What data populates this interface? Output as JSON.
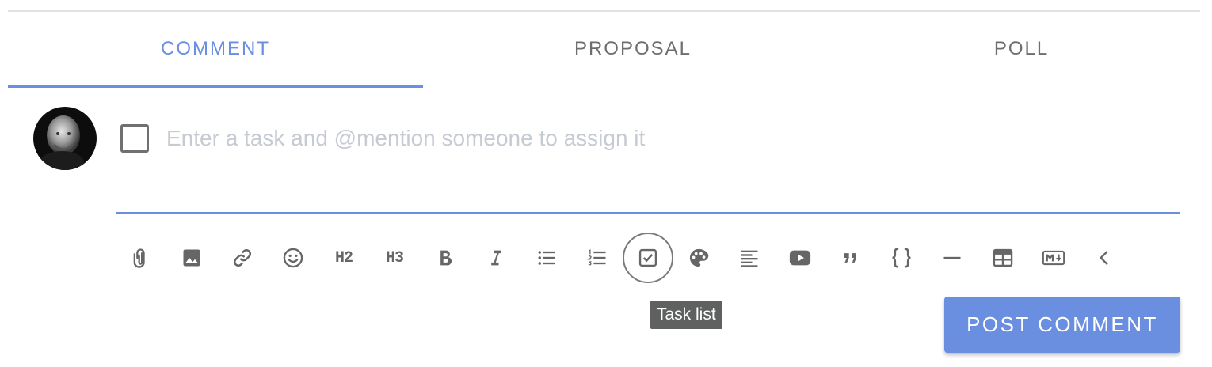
{
  "tabs": [
    {
      "label": "COMMENT",
      "active": true
    },
    {
      "label": "PROPOSAL",
      "active": false
    },
    {
      "label": "POLL",
      "active": false
    }
  ],
  "task_input": {
    "value": "",
    "placeholder": "Enter a task and @mention someone to assign it"
  },
  "toolbar": {
    "h2_label": "H2",
    "h3_label": "H3",
    "buttons": [
      "attachment-icon",
      "image-icon",
      "link-icon",
      "emoji-icon",
      "heading2-icon",
      "heading3-icon",
      "bold-icon",
      "italic-icon",
      "bullet-list-icon",
      "numbered-list-icon",
      "task-list-icon",
      "palette-icon",
      "align-icon",
      "video-icon",
      "quote-icon",
      "code-block-icon",
      "horizontal-rule-icon",
      "table-icon",
      "markdown-icon",
      "collapse-chevron-icon"
    ]
  },
  "tooltip": {
    "text": "Task list"
  },
  "post_button": {
    "label": "POST COMMENT"
  },
  "colors": {
    "accent": "#6a8ee0",
    "tab_inactive": "#6e6e6e",
    "placeholder": "#c6cad2",
    "icon": "#666666",
    "tooltip_bg": "#5f6060"
  }
}
